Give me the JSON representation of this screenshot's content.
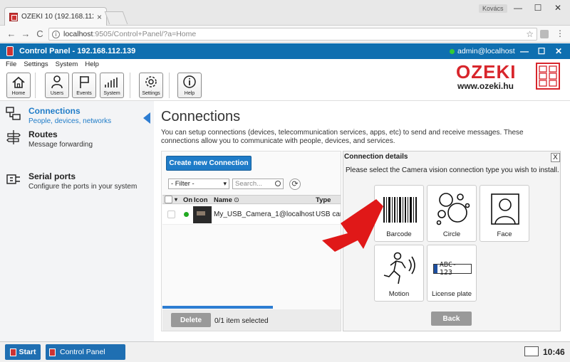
{
  "browser": {
    "tab_title": "OZEKI 10 (192.168.112.13",
    "tab_close": "×",
    "window_user": "Kovács",
    "url_host": "localhost",
    "url_path": ":9505/Control+Panel/?a=Home",
    "back": "←",
    "forward": "→",
    "reload": "C",
    "star": "☆",
    "menu": "⋮",
    "minimize": "—",
    "maximize": "☐",
    "close": "✕"
  },
  "app": {
    "title": "Control Panel - 192.168.112.139",
    "user": "admin@localhost",
    "minimize": "—",
    "maximize": "☐",
    "close": "✕"
  },
  "menu": [
    "File",
    "Settings",
    "System",
    "Help"
  ],
  "toolbar": {
    "home": "Home",
    "users": "Users",
    "events": "Events",
    "system": "System",
    "settings": "Settings",
    "help": "Help"
  },
  "logo": {
    "text": "OZEKI",
    "url": "www.ozeki.hu"
  },
  "sidebar": {
    "items": [
      {
        "title": "Connections",
        "sub": "People, devices, networks"
      },
      {
        "title": "Routes",
        "sub": "Message forwarding"
      },
      {
        "title": "Serial ports",
        "sub": "Configure the ports in your system"
      }
    ]
  },
  "main": {
    "title": "Connections",
    "description": "You can setup connections (devices, telecommunication services, apps, etc) to send and receive messages. These connections allow you to communicate with people, devices, and services."
  },
  "connections": {
    "create_button": "Create new Connection",
    "filter": "- Filter -",
    "search_placeholder": "Search...",
    "refresh": "⟳",
    "columns": {
      "on": "On",
      "icon": "Icon",
      "name": "Name",
      "type": "Type"
    },
    "rows": [
      {
        "name": "My_USB_Camera_1@localhost",
        "type": "USB camera"
      }
    ],
    "progress": 0.62,
    "delete_button": "Delete",
    "selected_text": "0/1 item selected"
  },
  "details": {
    "title": "Connection details",
    "close": "X",
    "description": "Please select the Camera vision connection type you wish to install.",
    "types": [
      "Barcode",
      "Circle",
      "Face",
      "Motion",
      "License plate"
    ],
    "plate_text": "ABC-123",
    "back_button": "Back"
  },
  "taskbar": {
    "start": "Start",
    "item": "Control Panel",
    "clock": "10:46"
  },
  "colors": {
    "accent": "#1f7cc8",
    "header": "#0f6fb0",
    "logo": "#d8262c",
    "arrow": "#e01818"
  }
}
